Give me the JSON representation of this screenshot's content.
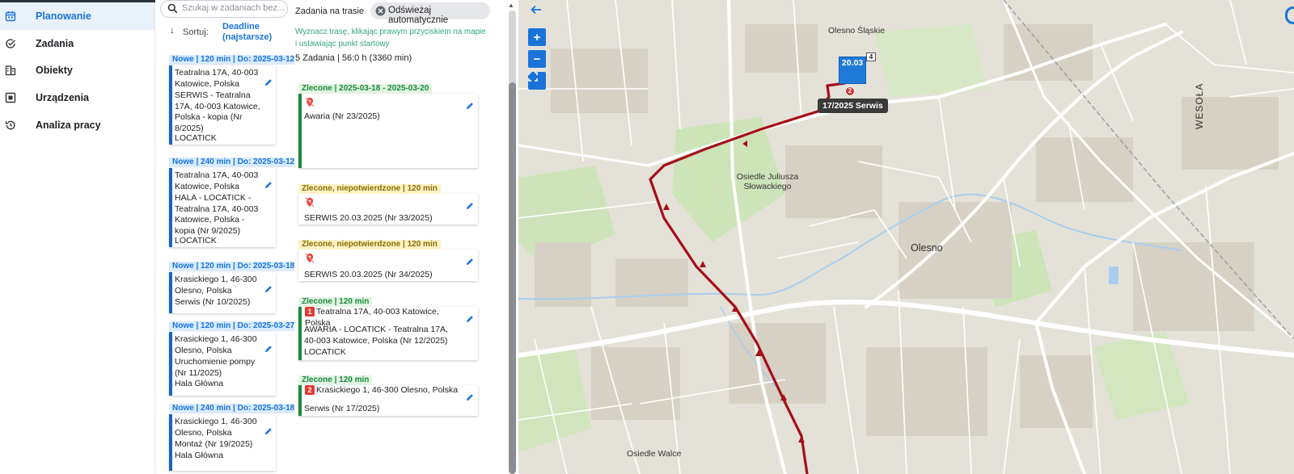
{
  "nav": {
    "items": [
      {
        "label": "Planowanie",
        "icon": "calendar-icon",
        "active": true
      },
      {
        "label": "Zadania",
        "icon": "task-check-icon",
        "active": false
      },
      {
        "label": "Obiekty",
        "icon": "building-icon",
        "active": false
      },
      {
        "label": "Urządzenia",
        "icon": "device-icon",
        "active": false
      },
      {
        "label": "Analiza pracy",
        "icon": "history-icon",
        "active": false
      }
    ]
  },
  "tasks": {
    "search_placeholder": "Szukaj w zadaniach bez...",
    "sort_label": "Sortuj:",
    "sort_value": "Deadline (najstarsze)",
    "cards": [
      {
        "header": "Nowe | 120 min | Do: 2025-03-12",
        "address": "Teatralna 17A, 40-003 Katowice, Polska",
        "description": "SERWIS - Teatralna 17A, 40-003 Katowice, Polska - kopia (Nr 8/2025)",
        "object": "LOCATICK"
      },
      {
        "header": "Nowe | 240 min | Do: 2025-03-12",
        "address": "Teatralna 17A, 40-003 Katowice, Polska",
        "description": "HALA - LOCATICK - Teatralna 17A, 40-003 Katowice, Polska - kopia (Nr 9/2025)",
        "object": "LOCATICK"
      },
      {
        "header": "Nowe | 120 min | Do: 2025-03-18",
        "address": "Krasickiego 1, 46-300 Olesno, Polska",
        "description": "Serwis (Nr 10/2025)",
        "object": ""
      },
      {
        "header": "Nowe | 120 min | Do: 2025-03-27",
        "address": "Krasickiego 1, 46-300 Olesno, Polska",
        "description": "Uruchomienie pompy (Nr 11/2025)",
        "object": "Hala Główna"
      },
      {
        "header": "Nowe | 240 min | Do: 2025-03-18",
        "address": "Krasickiego 1, 46-300 Olesno, Polska",
        "description": "Montaż (Nr 19/2025)",
        "object": "Hala Główna"
      }
    ]
  },
  "route": {
    "title": "Zadania na trasie",
    "auto_refresh_label": "Odświeżaj automatycznie",
    "hint": "Wyznacz trasę, klikając prawym przyciskiem na mapie i ustawiając punkt startowy",
    "summary": "5 Zadania | 56:0 h (3360 min)",
    "cards": [
      {
        "header": "Zlecone | 2025-03-18 - 2025-03-20",
        "tone": "green",
        "number": "",
        "address": "",
        "description": "Awaria (Nr 23/2025)",
        "object": "",
        "no_location": true
      },
      {
        "header": "Zlecone, niepotwierdzone | 120 min",
        "tone": "yellow",
        "number": "",
        "address": "",
        "description": "SERWIS 20.03.2025 (Nr 33/2025)",
        "object": "",
        "no_location": true
      },
      {
        "header": "Zlecone, niepotwierdzone | 120 min",
        "tone": "yellow",
        "number": "",
        "address": "",
        "description": "SERWIS 20.03.2025 (Nr 34/2025)",
        "object": "",
        "no_location": true
      },
      {
        "header": "Zlecone | 120 min",
        "tone": "green",
        "number": "1",
        "address": "Teatralna 17A, 40-003 Katowice, Polska",
        "description": "AWARIA - LOCATICK - Teatralna 17A, 40-003 Katowice, Polska (Nr 12/2025)",
        "object": "LOCATICK",
        "no_location": false
      },
      {
        "header": "Zlecone | 120 min",
        "tone": "green",
        "number": "2",
        "address": "Krasickiego 1, 46-300 Olesno, Polska",
        "description": "Serwis (Nr 17/2025)",
        "object": "",
        "no_location": false
      }
    ]
  },
  "map": {
    "zoom_in": "+",
    "zoom_out": "−",
    "marker_date": "20.03",
    "marker_count": "4",
    "pin_number": "2",
    "tooltip": "17/2025 Serwis",
    "labels": {
      "olesno": "Olesno",
      "olesno_slaskie": "Olesno Śląskie",
      "osiedle_slowackiego": "Osiedle Juliusza Słowackiego",
      "osiedle_walce": "Osiedle Walce",
      "wesola": "WESOŁA"
    },
    "colors": {
      "route": "#a50e18",
      "water": "#aacdef",
      "park": "#cde3b8",
      "accent": "#1a73d9"
    }
  }
}
